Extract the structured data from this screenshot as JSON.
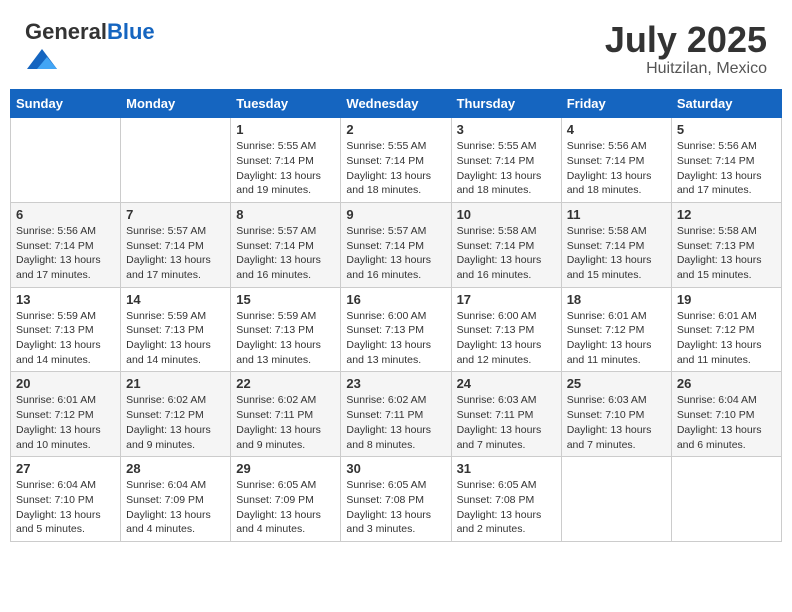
{
  "header": {
    "logo_general": "General",
    "logo_blue": "Blue",
    "month_year": "July 2025",
    "location": "Huitzilan, Mexico"
  },
  "weekdays": [
    "Sunday",
    "Monday",
    "Tuesday",
    "Wednesday",
    "Thursday",
    "Friday",
    "Saturday"
  ],
  "weeks": [
    [
      {
        "day": "",
        "info": ""
      },
      {
        "day": "",
        "info": ""
      },
      {
        "day": "1",
        "info": "Sunrise: 5:55 AM\nSunset: 7:14 PM\nDaylight: 13 hours and 19 minutes."
      },
      {
        "day": "2",
        "info": "Sunrise: 5:55 AM\nSunset: 7:14 PM\nDaylight: 13 hours and 18 minutes."
      },
      {
        "day": "3",
        "info": "Sunrise: 5:55 AM\nSunset: 7:14 PM\nDaylight: 13 hours and 18 minutes."
      },
      {
        "day": "4",
        "info": "Sunrise: 5:56 AM\nSunset: 7:14 PM\nDaylight: 13 hours and 18 minutes."
      },
      {
        "day": "5",
        "info": "Sunrise: 5:56 AM\nSunset: 7:14 PM\nDaylight: 13 hours and 17 minutes."
      }
    ],
    [
      {
        "day": "6",
        "info": "Sunrise: 5:56 AM\nSunset: 7:14 PM\nDaylight: 13 hours and 17 minutes."
      },
      {
        "day": "7",
        "info": "Sunrise: 5:57 AM\nSunset: 7:14 PM\nDaylight: 13 hours and 17 minutes."
      },
      {
        "day": "8",
        "info": "Sunrise: 5:57 AM\nSunset: 7:14 PM\nDaylight: 13 hours and 16 minutes."
      },
      {
        "day": "9",
        "info": "Sunrise: 5:57 AM\nSunset: 7:14 PM\nDaylight: 13 hours and 16 minutes."
      },
      {
        "day": "10",
        "info": "Sunrise: 5:58 AM\nSunset: 7:14 PM\nDaylight: 13 hours and 16 minutes."
      },
      {
        "day": "11",
        "info": "Sunrise: 5:58 AM\nSunset: 7:14 PM\nDaylight: 13 hours and 15 minutes."
      },
      {
        "day": "12",
        "info": "Sunrise: 5:58 AM\nSunset: 7:13 PM\nDaylight: 13 hours and 15 minutes."
      }
    ],
    [
      {
        "day": "13",
        "info": "Sunrise: 5:59 AM\nSunset: 7:13 PM\nDaylight: 13 hours and 14 minutes."
      },
      {
        "day": "14",
        "info": "Sunrise: 5:59 AM\nSunset: 7:13 PM\nDaylight: 13 hours and 14 minutes."
      },
      {
        "day": "15",
        "info": "Sunrise: 5:59 AM\nSunset: 7:13 PM\nDaylight: 13 hours and 13 minutes."
      },
      {
        "day": "16",
        "info": "Sunrise: 6:00 AM\nSunset: 7:13 PM\nDaylight: 13 hours and 13 minutes."
      },
      {
        "day": "17",
        "info": "Sunrise: 6:00 AM\nSunset: 7:13 PM\nDaylight: 13 hours and 12 minutes."
      },
      {
        "day": "18",
        "info": "Sunrise: 6:01 AM\nSunset: 7:12 PM\nDaylight: 13 hours and 11 minutes."
      },
      {
        "day": "19",
        "info": "Sunrise: 6:01 AM\nSunset: 7:12 PM\nDaylight: 13 hours and 11 minutes."
      }
    ],
    [
      {
        "day": "20",
        "info": "Sunrise: 6:01 AM\nSunset: 7:12 PM\nDaylight: 13 hours and 10 minutes."
      },
      {
        "day": "21",
        "info": "Sunrise: 6:02 AM\nSunset: 7:12 PM\nDaylight: 13 hours and 9 minutes."
      },
      {
        "day": "22",
        "info": "Sunrise: 6:02 AM\nSunset: 7:11 PM\nDaylight: 13 hours and 9 minutes."
      },
      {
        "day": "23",
        "info": "Sunrise: 6:02 AM\nSunset: 7:11 PM\nDaylight: 13 hours and 8 minutes."
      },
      {
        "day": "24",
        "info": "Sunrise: 6:03 AM\nSunset: 7:11 PM\nDaylight: 13 hours and 7 minutes."
      },
      {
        "day": "25",
        "info": "Sunrise: 6:03 AM\nSunset: 7:10 PM\nDaylight: 13 hours and 7 minutes."
      },
      {
        "day": "26",
        "info": "Sunrise: 6:04 AM\nSunset: 7:10 PM\nDaylight: 13 hours and 6 minutes."
      }
    ],
    [
      {
        "day": "27",
        "info": "Sunrise: 6:04 AM\nSunset: 7:10 PM\nDaylight: 13 hours and 5 minutes."
      },
      {
        "day": "28",
        "info": "Sunrise: 6:04 AM\nSunset: 7:09 PM\nDaylight: 13 hours and 4 minutes."
      },
      {
        "day": "29",
        "info": "Sunrise: 6:05 AM\nSunset: 7:09 PM\nDaylight: 13 hours and 4 minutes."
      },
      {
        "day": "30",
        "info": "Sunrise: 6:05 AM\nSunset: 7:08 PM\nDaylight: 13 hours and 3 minutes."
      },
      {
        "day": "31",
        "info": "Sunrise: 6:05 AM\nSunset: 7:08 PM\nDaylight: 13 hours and 2 minutes."
      },
      {
        "day": "",
        "info": ""
      },
      {
        "day": "",
        "info": ""
      }
    ]
  ]
}
